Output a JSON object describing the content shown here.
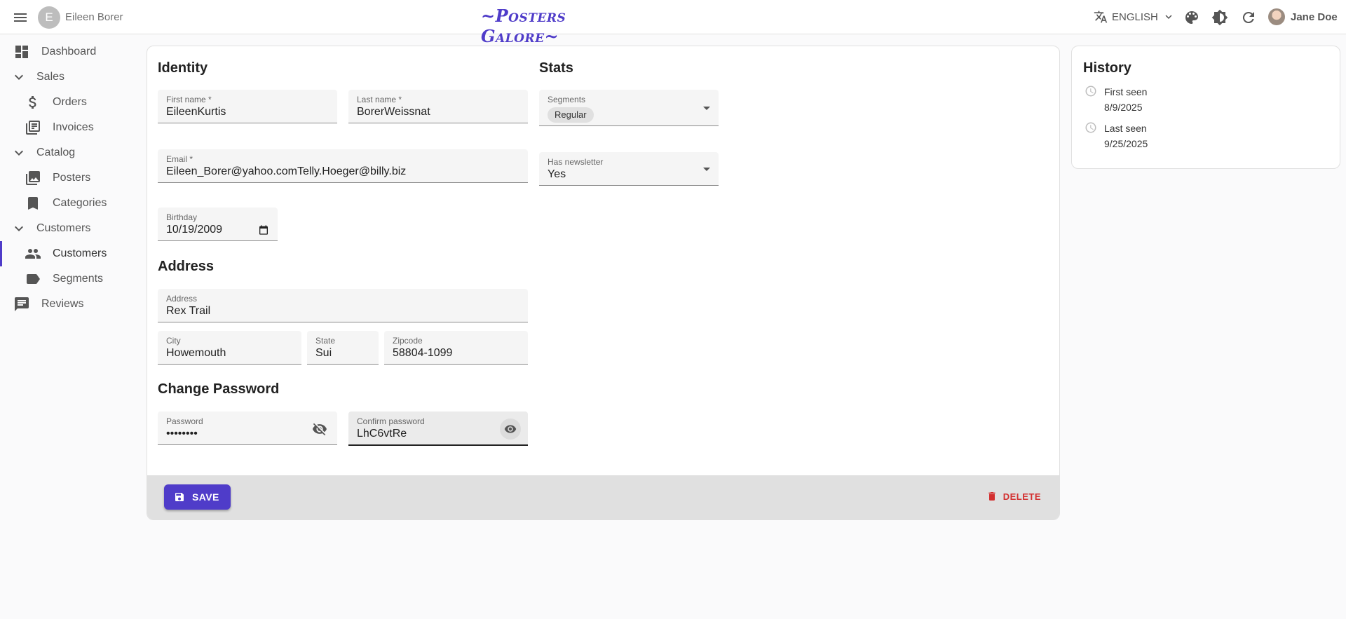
{
  "app": {
    "brand": "~Posters Galore~",
    "breadcrumb": {
      "initial": "E",
      "name": "Eileen Borer"
    },
    "language": "ENGLISH",
    "user": "Jane Doe",
    "accent_color": "#4f3cc9"
  },
  "sidebar": {
    "items": [
      {
        "label": "Dashboard",
        "icon": "dashboard-icon"
      },
      {
        "label": "Sales",
        "icon": "chevron-down-icon"
      },
      {
        "label": "Orders",
        "icon": "dollar-icon"
      },
      {
        "label": "Invoices",
        "icon": "library-books-icon"
      },
      {
        "label": "Catalog",
        "icon": "chevron-down-icon"
      },
      {
        "label": "Posters",
        "icon": "photo-library-icon"
      },
      {
        "label": "Categories",
        "icon": "bookmark-icon"
      },
      {
        "label": "Customers",
        "icon": "chevron-down-icon"
      },
      {
        "label": "Customers",
        "icon": "people-icon",
        "active": true
      },
      {
        "label": "Segments",
        "icon": "label-icon"
      },
      {
        "label": "Reviews",
        "icon": "comment-icon"
      }
    ]
  },
  "identity": {
    "title": "Identity",
    "first_name": {
      "label": "First name *",
      "value": "EileenKurtis"
    },
    "last_name": {
      "label": "Last name *",
      "value": "BorerWeissnat"
    },
    "email": {
      "label": "Email *",
      "value": "Eileen_Borer@yahoo.comTelly.Hoeger@billy.biz"
    },
    "birthday": {
      "label": "Birthday",
      "value": "10/19/2009"
    }
  },
  "stats": {
    "title": "Stats",
    "segments": {
      "label": "Segments",
      "chips": [
        "Regular"
      ]
    },
    "newsletter": {
      "label": "Has newsletter",
      "value": "Yes"
    }
  },
  "address": {
    "title": "Address",
    "address": {
      "label": "Address",
      "value": "Rex Trail"
    },
    "city": {
      "label": "City",
      "value": "Howemouth"
    },
    "state": {
      "label": "State",
      "value": "Sui"
    },
    "zipcode": {
      "label": "Zipcode",
      "value": "58804-1099"
    }
  },
  "password": {
    "title": "Change Password",
    "password": {
      "label": "Password",
      "value": "••••••••"
    },
    "confirm": {
      "label": "Confirm password",
      "value": "LhC6vtRe"
    }
  },
  "toolbar": {
    "save_label": "SAVE",
    "delete_label": "DELETE"
  },
  "history": {
    "title": "History",
    "first_seen": {
      "label": "First seen",
      "date": "8/9/2025"
    },
    "last_seen": {
      "label": "Last seen",
      "date": "9/25/2025"
    }
  }
}
